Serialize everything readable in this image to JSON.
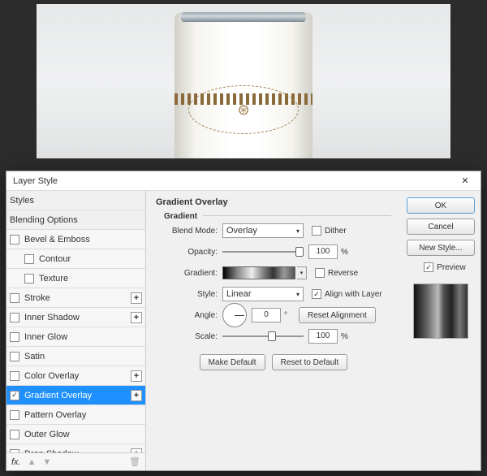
{
  "dialog": {
    "title": "Layer Style",
    "section_title": "Gradient Overlay",
    "group_title": "Gradient"
  },
  "styles": {
    "header": "Styles",
    "blending": "Blending Options",
    "bevel": "Bevel & Emboss",
    "contour": "Contour",
    "texture": "Texture",
    "stroke": "Stroke",
    "inner_shadow": "Inner Shadow",
    "inner_glow": "Inner Glow",
    "satin": "Satin",
    "color_overlay": "Color Overlay",
    "gradient_overlay": "Gradient Overlay",
    "pattern_overlay": "Pattern Overlay",
    "outer_glow": "Outer Glow",
    "drop_shadow": "Drop Shadow"
  },
  "footer": {
    "fx": "fx."
  },
  "form": {
    "blend_mode_label": "Blend Mode:",
    "blend_mode_value": "Overlay",
    "dither_label": "Dither",
    "opacity_label": "Opacity:",
    "opacity_value": "100",
    "gradient_label": "Gradient:",
    "reverse_label": "Reverse",
    "style_label": "Style:",
    "style_value": "Linear",
    "align_label": "Align with Layer",
    "angle_label": "Angle:",
    "angle_value": "0",
    "degree": "°",
    "reset_alignment": "Reset Alignment",
    "scale_label": "Scale:",
    "scale_value": "100",
    "percent": "%",
    "make_default": "Make Default",
    "reset_default": "Reset to Default"
  },
  "buttons": {
    "ok": "OK",
    "cancel": "Cancel",
    "new_style": "New Style...",
    "preview": "Preview"
  }
}
